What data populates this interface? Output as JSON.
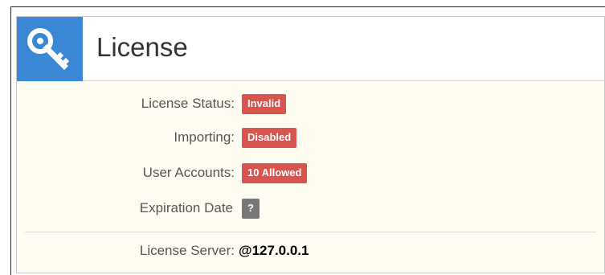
{
  "panel": {
    "title": "License",
    "icon": "key-icon",
    "accent_color": "#3a87d6"
  },
  "rows": [
    {
      "label": "License Status:",
      "badge": "Invalid",
      "badge_color": "#d9534f"
    },
    {
      "label": "Importing:",
      "badge": "Disabled",
      "badge_color": "#d9534f"
    },
    {
      "label": "User Accounts:",
      "badge": "10 Allowed",
      "badge_color": "#d9534f"
    },
    {
      "label": "Expiration Date",
      "badge": "?",
      "badge_color": "#777777"
    }
  ],
  "server": {
    "label": "License Server:",
    "value": "@127.0.0.1"
  }
}
